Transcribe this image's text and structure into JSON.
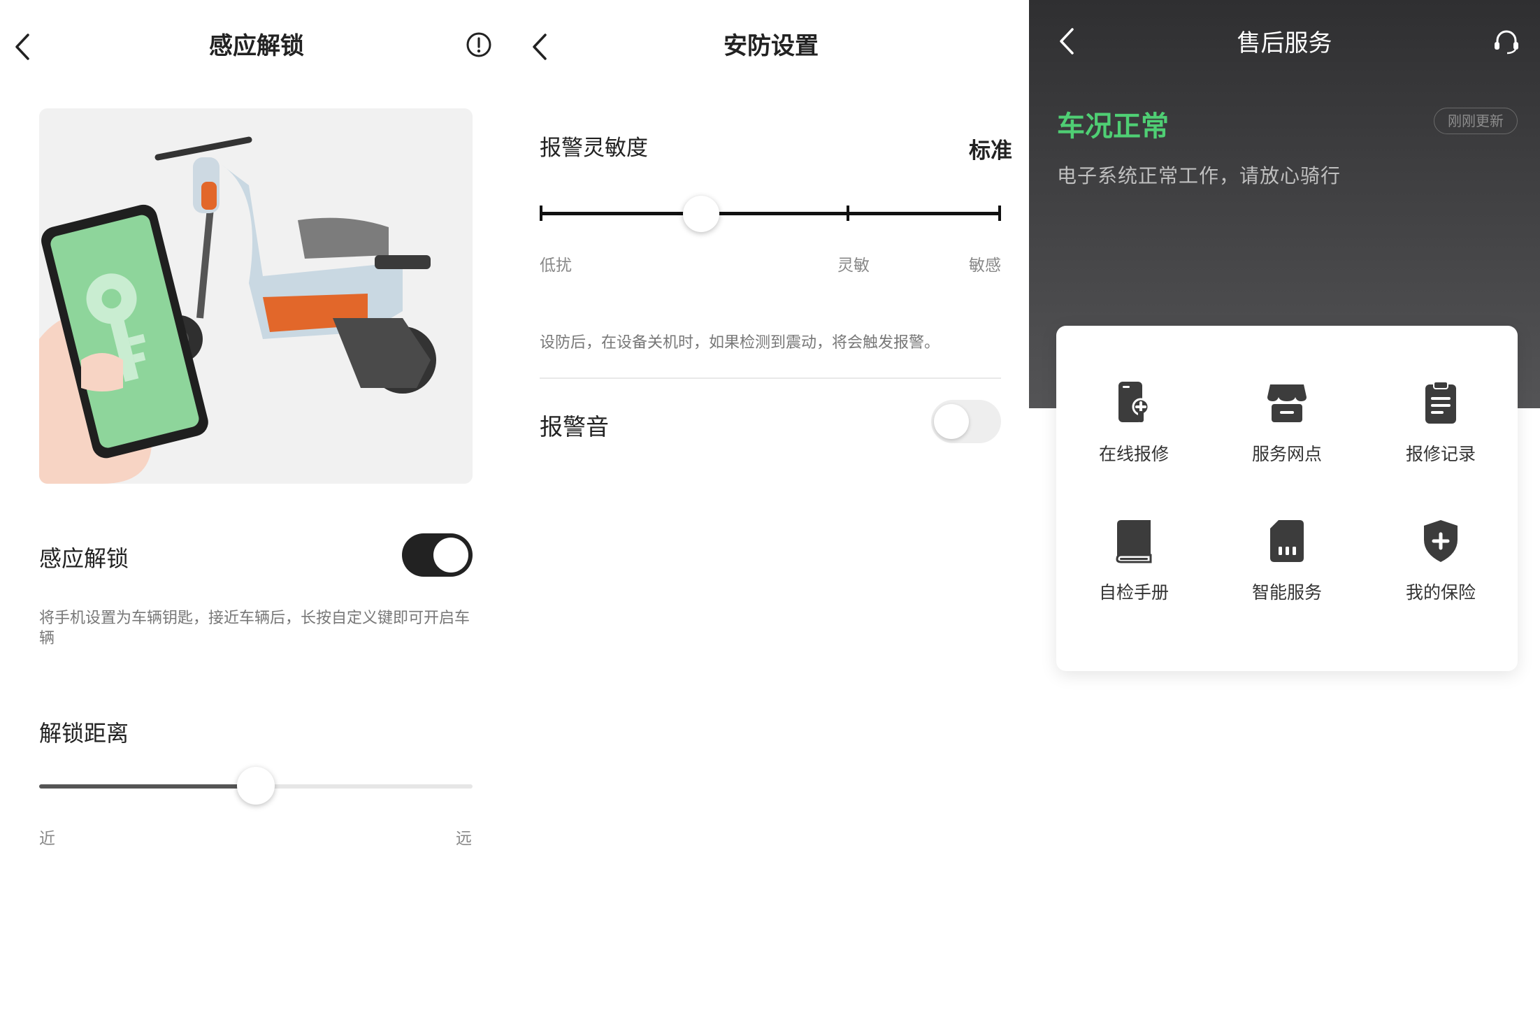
{
  "screen1": {
    "title": "感应解锁",
    "unlock_label": "感应解锁",
    "unlock_enabled": true,
    "unlock_desc": "将手机设置为车辆钥匙，接近车辆后，长按自定义键即可开启车辆",
    "distance_label": "解锁距离",
    "distance_min_label": "近",
    "distance_max_label": "远",
    "distance_value": 0.5
  },
  "screen2": {
    "title": "安防设置",
    "sensitivity_label": "报警灵敏度",
    "sensitivity_value": "标准",
    "sensitivity_ticks": [
      "低扰",
      "灵敏",
      "敏感"
    ],
    "sensitivity_position": 0.35,
    "desc": "设防后，在设备关机时，如果检测到震动，将会触发报警。",
    "alarm_sound_label": "报警音",
    "alarm_sound_enabled": false
  },
  "screen3": {
    "title": "售后服务",
    "status_title": "车况正常",
    "status_badge": "刚刚更新",
    "status_desc": "电子系统正常工作，请放心骑行",
    "grid": [
      {
        "label": "在线报修",
        "icon": "phone-wrench-icon"
      },
      {
        "label": "服务网点",
        "icon": "store-icon"
      },
      {
        "label": "报修记录",
        "icon": "clipboard-icon"
      },
      {
        "label": "自检手册",
        "icon": "book-icon"
      },
      {
        "label": "智能服务",
        "icon": "sim-card-icon"
      },
      {
        "label": "我的保险",
        "icon": "shield-plus-icon"
      }
    ]
  },
  "colors": {
    "accent_green": "#4fcf74",
    "toggle_on": "#222222",
    "toggle_off": "#eeeeee",
    "dark_header": "#3a3a3c"
  }
}
